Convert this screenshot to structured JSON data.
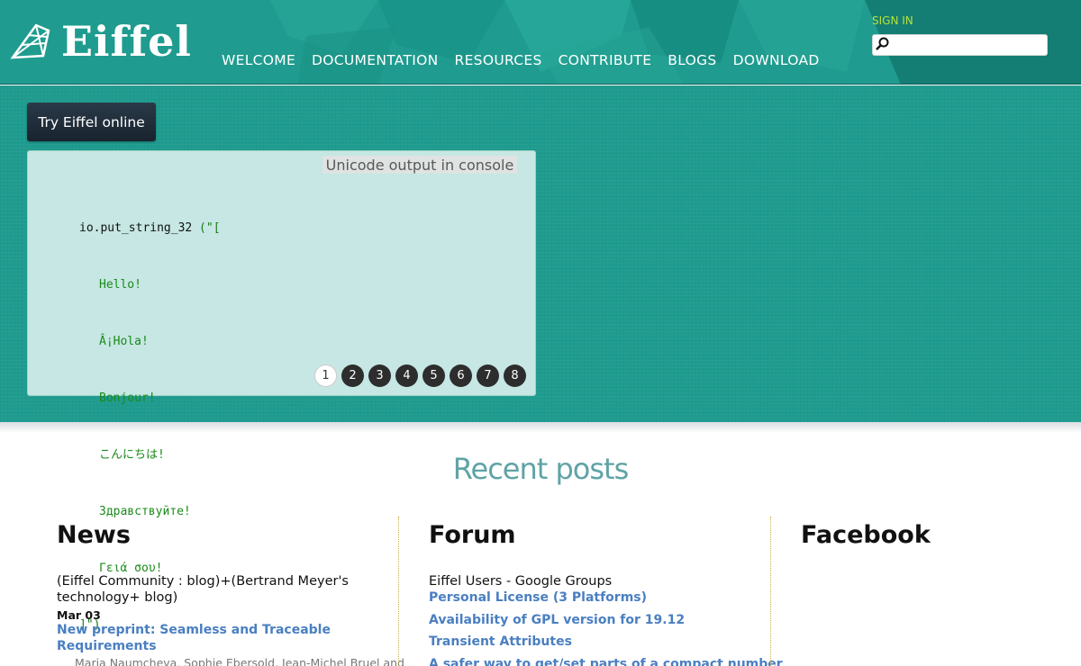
{
  "header": {
    "logo_text": "Eiffel",
    "nav": [
      "WELCOME",
      "DOCUMENTATION",
      "RESOURCES",
      "CONTRIBUTE",
      "BLOGS",
      "DOWNLOAD"
    ],
    "sign_in": "SIGN IN",
    "search_placeholder": ""
  },
  "hero": {
    "try_button": "Try Eiffel online",
    "caption": "Unicode output in console",
    "code": {
      "object": "io",
      "method": "put_string_32",
      "open": " (\"[",
      "lines": [
        "Hello!",
        "Â¡Hola!",
        "Bonjour!",
        "こんにちは!",
        "Здравствуйте!",
        "Γειά σου!"
      ],
      "close": "]\")"
    },
    "pager": [
      "1",
      "2",
      "3",
      "4",
      "5",
      "6",
      "7",
      "8"
    ],
    "active_page": "1"
  },
  "recent": {
    "title": "Recent posts",
    "news": {
      "heading": "News",
      "source": "(Eiffel Community : blog)+(Bertrand Meyer's technology+ blog)",
      "date": "Mar 03",
      "post_title": "New preprint: Seamless and Traceable Requirements",
      "authors": "Maria Naumcheva, Sophie Ebersold, Jean-Michel Bruel and"
    },
    "forum": {
      "heading": "Forum",
      "source": "Eiffel Users - Google Groups",
      "links": [
        "Personal License (3 Platforms)",
        "Availability of GPL version for 19.12",
        "Transient Attributes",
        "A safer way to get/set parts of a compact number"
      ]
    },
    "facebook": {
      "heading": "Facebook"
    }
  },
  "colors": {
    "teal": "#1f9c8f",
    "link": "#4a7fc1",
    "sign_in": "#b7e23e",
    "recent_title": "#5fa3a6"
  }
}
